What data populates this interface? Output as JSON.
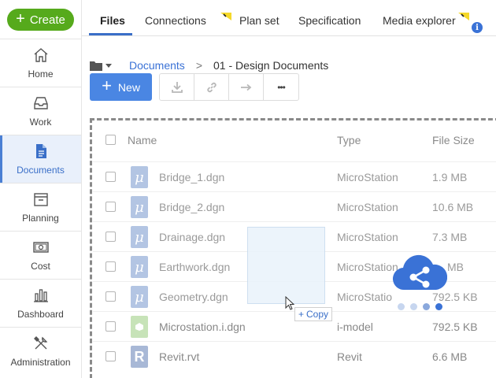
{
  "sidebar": {
    "create_label": "Create",
    "items": [
      {
        "label": "Home",
        "icon": "home-icon",
        "active": false
      },
      {
        "label": "Work",
        "icon": "inbox-icon",
        "active": false
      },
      {
        "label": "Documents",
        "icon": "document-icon",
        "active": true
      },
      {
        "label": "Planning",
        "icon": "planning-icon",
        "active": false
      },
      {
        "label": "Cost",
        "icon": "cost-icon",
        "active": false
      },
      {
        "label": "Dashboard",
        "icon": "dashboard-icon",
        "active": false
      },
      {
        "label": "Administration",
        "icon": "tools-icon",
        "active": false
      }
    ]
  },
  "tabs": [
    {
      "label": "Files",
      "active": true
    },
    {
      "label": "Connections",
      "active": false
    },
    {
      "label": "Plan set",
      "active": false
    },
    {
      "label": "Specification",
      "active": false
    },
    {
      "label": "Media explorer",
      "active": false
    }
  ],
  "info_badge": "i",
  "breadcrumb": {
    "root": "Documents",
    "separator": ">",
    "current": "01 - Design Documents"
  },
  "toolbar": {
    "new_label": "New",
    "more_label": "•••"
  },
  "table": {
    "headers": {
      "name": "Name",
      "type": "Type",
      "size": "File Size"
    },
    "rows": [
      {
        "name": "Bridge_1.dgn",
        "type": "MicroStation",
        "size": "1.9 MB",
        "icon": "microstation-icon"
      },
      {
        "name": "Bridge_2.dgn",
        "type": "MicroStation",
        "size": "10.6 MB",
        "icon": "microstation-icon"
      },
      {
        "name": "Drainage.dgn",
        "type": "MicroStation",
        "size": "7.3 MB",
        "icon": "microstation-icon"
      },
      {
        "name": "Earthwork.dgn",
        "type": "MicroStation",
        "size": "MB",
        "icon": "microstation-icon"
      },
      {
        "name": "Geometry.dgn",
        "type": "MicroStatio",
        "size": "792.5 KB",
        "icon": "microstation-icon"
      },
      {
        "name": "Microstation.i.dgn",
        "type": "i-model",
        "size": "792.5 KB",
        "icon": "imodel-icon"
      },
      {
        "name": "Revit.rvt",
        "type": "Revit",
        "size": "6.6 MB",
        "icon": "revit-icon"
      }
    ]
  },
  "drag": {
    "copy_label": "Copy"
  },
  "colors": {
    "create_green": "#56aa1c",
    "accent_blue": "#3a72d6",
    "flag_yellow": "#f5d82a"
  }
}
